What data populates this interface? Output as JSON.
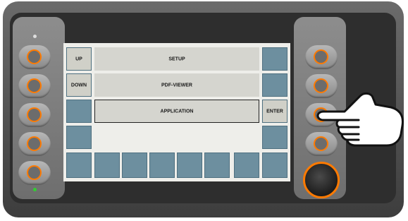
{
  "device": {
    "accent_color": "#ff7a00",
    "led_top_color": "#dddddd",
    "led_bottom_color": "#33cc33",
    "icons": [
      "pointing-hand-icon"
    ]
  },
  "screen": {
    "left_keys": {
      "up": "UP",
      "down": "DOWN"
    },
    "menu_items": [
      "SETUP",
      "PDF-VIEWER",
      "APPLICATION"
    ],
    "selected_item": "APPLICATION",
    "right_keys": {
      "enter": "ENTER"
    }
  }
}
